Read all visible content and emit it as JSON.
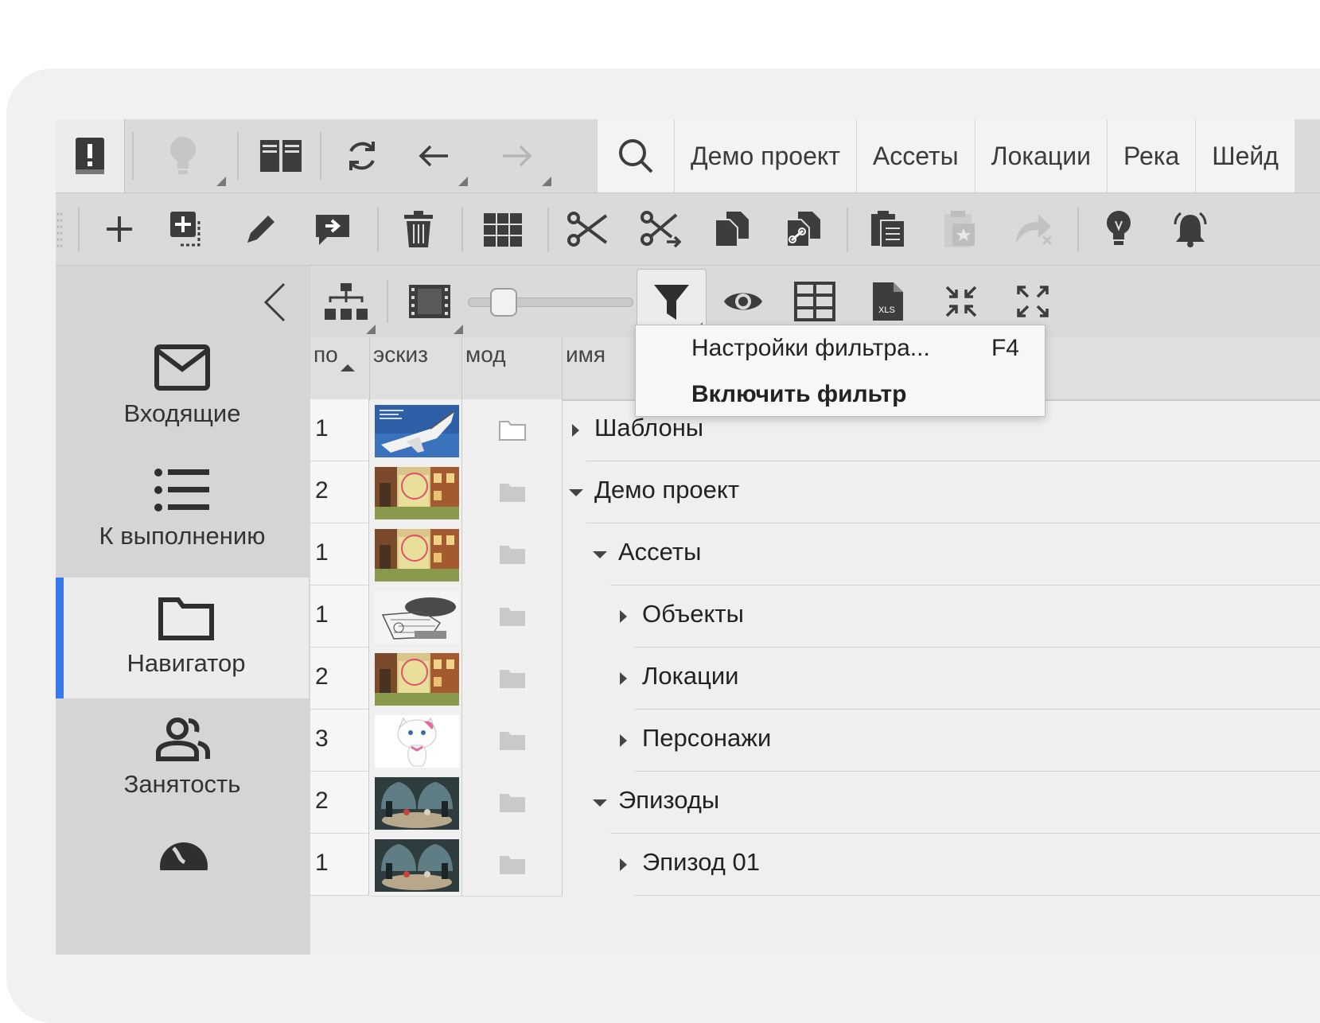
{
  "breadcrumbs": [
    "Демо проект",
    "Ассеты",
    "Локации",
    "Река",
    "Шейд"
  ],
  "sidebar": {
    "items": [
      {
        "label": "Входящие",
        "icon": "mail-icon"
      },
      {
        "label": "К выполнению",
        "icon": "list-icon"
      },
      {
        "label": "Навигатор",
        "icon": "folder-icon",
        "active": true
      },
      {
        "label": "Занятость",
        "icon": "people-icon"
      }
    ]
  },
  "columns": {
    "pos": "по",
    "thumb": "эскиз",
    "mod": "мод",
    "name": "имя"
  },
  "rows": [
    {
      "pos": "1",
      "name": "Шаблоны",
      "expand": "collapsed",
      "indent": 0,
      "thumb": "shuttle"
    },
    {
      "pos": "2",
      "name": "Демо проект",
      "expand": "expanded",
      "indent": 0,
      "thumb": "town"
    },
    {
      "pos": "1",
      "name": "Ассеты",
      "expand": "expanded",
      "indent": 1,
      "thumb": "town"
    },
    {
      "pos": "1",
      "name": "Объекты",
      "expand": "collapsed",
      "indent": 2,
      "thumb": "sketch"
    },
    {
      "pos": "2",
      "name": "Локации",
      "expand": "collapsed",
      "indent": 2,
      "thumb": "town"
    },
    {
      "pos": "3",
      "name": "Персонажи",
      "expand": "collapsed",
      "indent": 2,
      "thumb": "cat"
    },
    {
      "pos": "2",
      "name": "Эпизоды",
      "expand": "expanded",
      "indent": 1,
      "thumb": "room"
    },
    {
      "pos": "1",
      "name": "Эпизод 01",
      "expand": "collapsed",
      "indent": 2,
      "thumb": "room"
    }
  ],
  "dropdown": {
    "items": [
      {
        "label": "Настройки фильтра...",
        "shortcut": "F4"
      },
      {
        "label": "Включить фильтр",
        "shortcut": ""
      }
    ]
  },
  "colors": {
    "accent": "#3a78ee",
    "toolbar": "#dadada",
    "sidebar": "#d5d5d5"
  }
}
